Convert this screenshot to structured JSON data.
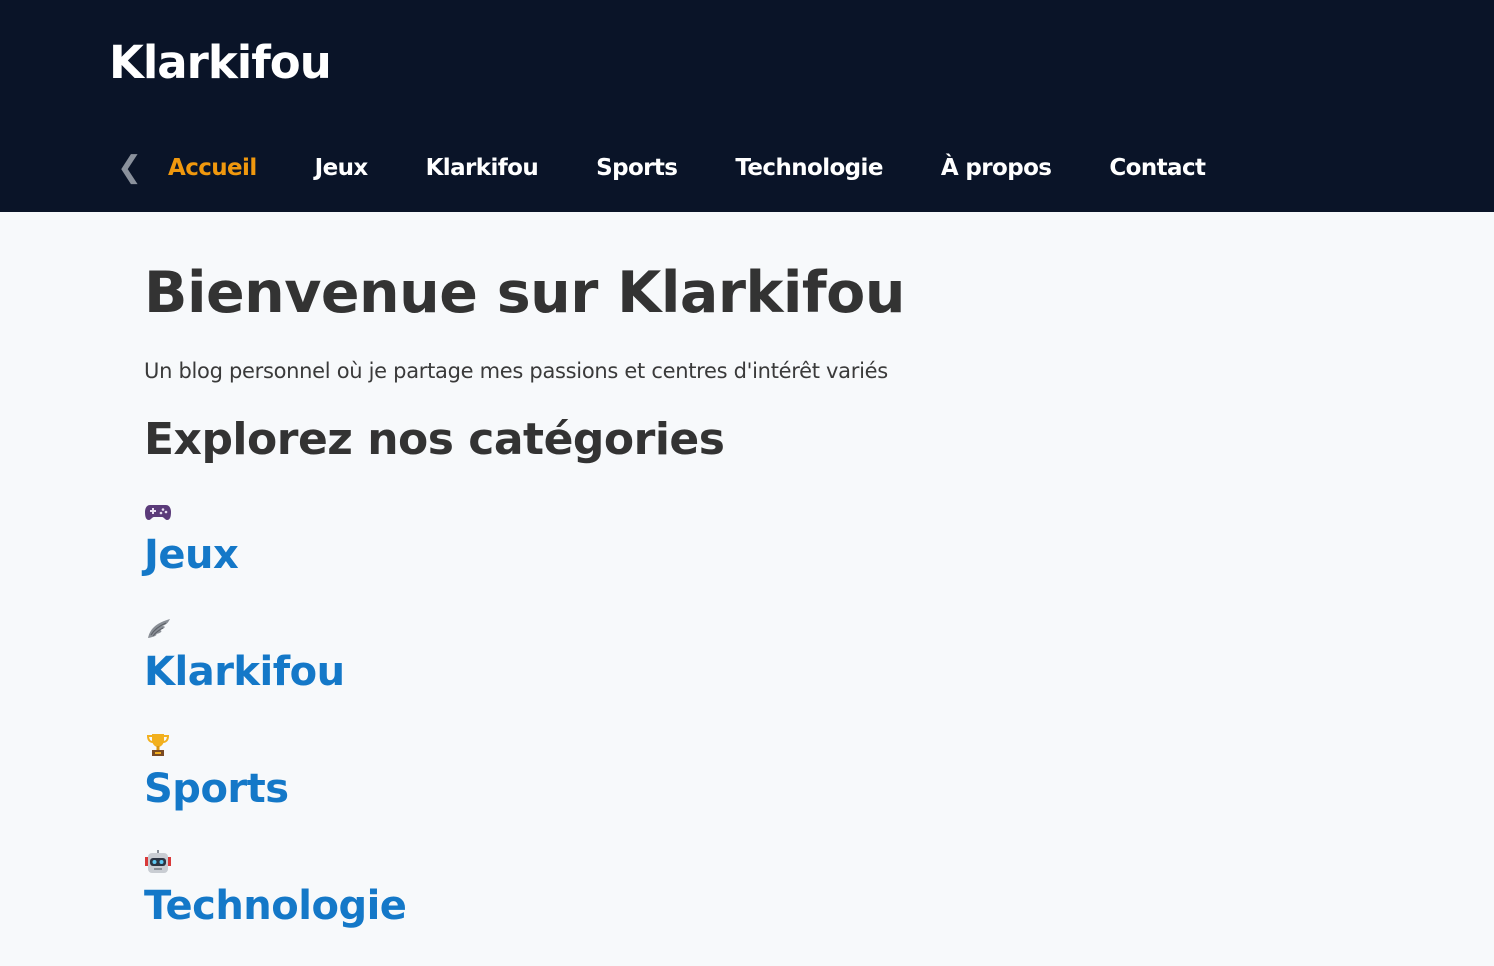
{
  "header": {
    "logo": "Klarkifou",
    "nav": {
      "back_glyph": "❮",
      "items": [
        {
          "label": "Accueil",
          "active": true
        },
        {
          "label": "Jeux",
          "active": false
        },
        {
          "label": "Klarkifou",
          "active": false
        },
        {
          "label": "Sports",
          "active": false
        },
        {
          "label": "Technologie",
          "active": false
        },
        {
          "label": "À propos",
          "active": false
        },
        {
          "label": "Contact",
          "active": false
        }
      ]
    }
  },
  "main": {
    "title": "Bienvenue sur Klarkifou",
    "subtitle": "Un blog personnel où je partage mes passions et centres d'intérêt variés",
    "section_title": "Explorez nos catégories",
    "categories": [
      {
        "icon": "gamepad-icon",
        "name": "Jeux"
      },
      {
        "icon": "wing-icon",
        "name": "Klarkifou"
      },
      {
        "icon": "trophy-icon",
        "name": "Sports"
      },
      {
        "icon": "robot-icon",
        "name": "Technologie"
      }
    ]
  },
  "colors": {
    "header_bg": "#0a1428",
    "accent_active": "#f0980e",
    "link_blue": "#1478c8",
    "page_bg": "#f7f9fb",
    "text_dark": "#333333"
  }
}
